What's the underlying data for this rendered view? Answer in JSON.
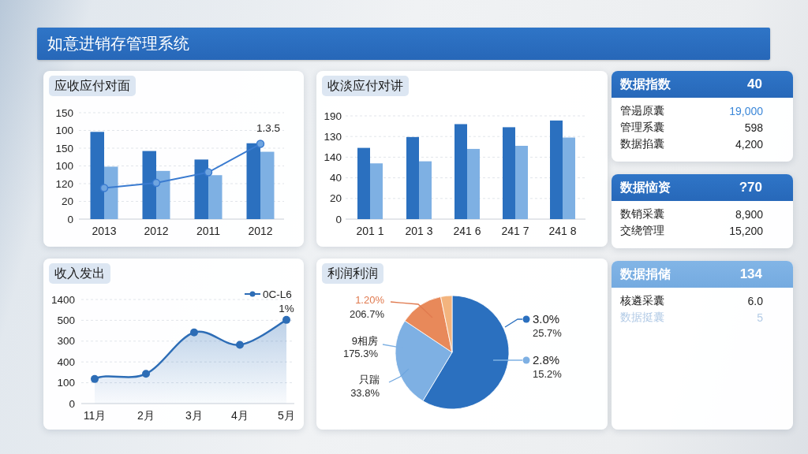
{
  "header": {
    "title": "如意进销存管理系统"
  },
  "charts": [
    {
      "kind": "bar-line",
      "title": "应收应付对面",
      "y_labels": [
        "150",
        "100",
        "150",
        "100",
        "120",
        "20",
        "0"
      ],
      "x_labels": [
        "2013",
        "2012",
        "2011",
        "2012"
      ],
      "annotation": "1.3.5"
    },
    {
      "kind": "bar",
      "title": "收淡应付对讲",
      "y_labels": [
        "190",
        "130",
        "140",
        "40",
        "20",
        "0"
      ],
      "x_labels": [
        "201 1",
        "201 3",
        "241 6",
        "241 7",
        "241 8"
      ]
    },
    {
      "kind": "area",
      "title": "收入发出",
      "y_labels": [
        "1400",
        "500",
        "300",
        "400",
        "100",
        "0"
      ],
      "x_labels": [
        "11月",
        "2月",
        "3月",
        "4月",
        "5月"
      ],
      "legend": "0C-L6",
      "annotation": "1%"
    }
  ],
  "stat_cards": [
    {
      "kind": "dark",
      "title": "数据指数",
      "value": "40",
      "rows": [
        {
          "label": "管遢原囊",
          "value": "19,000",
          "highlight": true,
          "disabled": false
        },
        {
          "label": "管理系囊",
          "value": "598",
          "highlight": false,
          "disabled": false
        },
        {
          "label": "数据掐囊",
          "value": "4,200",
          "highlight": false,
          "disabled": false
        }
      ]
    },
    {
      "kind": "dark",
      "title": "数据恼资",
      "value": "?70",
      "rows": [
        {
          "label": "数销采囊",
          "value": "8,900",
          "highlight": false,
          "disabled": false
        },
        {
          "label": "交绕管理",
          "value": "15,200",
          "highlight": false,
          "disabled": false
        }
      ]
    },
    {
      "kind": "light",
      "title": "数据捐储",
      "value": "134",
      "rows": [
        {
          "label": "核遴采囊",
          "value": "6.0",
          "highlight": false,
          "disabled": false
        },
        {
          "label": "数据挺囊",
          "value": "5",
          "highlight": false,
          "disabled": true
        }
      ]
    }
  ],
  "pie_panel": {
    "title": "利润利润",
    "callouts": [
      {
        "label": "1.20%",
        "value": "206.7%",
        "color": "#e07a4f",
        "accent": true,
        "dot": false
      },
      {
        "label": "9相房",
        "value": "175.3%",
        "color": "#7eb0e3",
        "accent": false,
        "dot": false
      },
      {
        "label": "只踹",
        "value": "33.8%",
        "color": "#6fa6df",
        "accent": false,
        "dot": false
      },
      {
        "label": "3.0%",
        "value": "25.7%",
        "color": "#2b70bf",
        "accent": false,
        "dot": true
      },
      {
        "label": "2.8%",
        "value": "15.2%",
        "color": "#7eb0e3",
        "accent": false,
        "dot": true
      }
    ]
  }
}
